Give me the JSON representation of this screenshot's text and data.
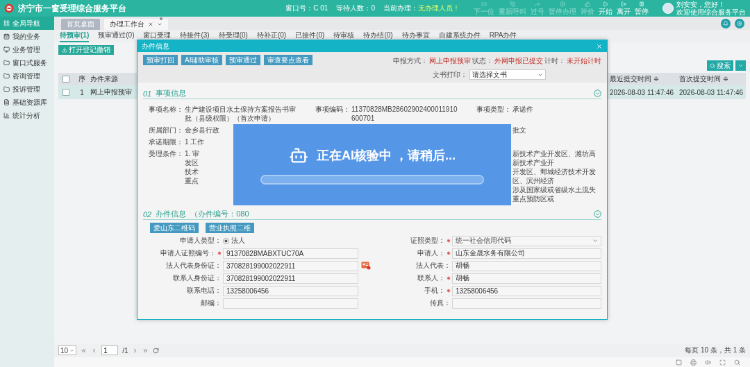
{
  "header": {
    "title": "济宁市一窗受理综合服务平台",
    "window_no": "窗口号：C 01",
    "waiting": "等待人数：0",
    "current_label": "当前办理：",
    "current_value": "无办理人员！",
    "tools": [
      {
        "label": "下一位",
        "disabled": true
      },
      {
        "label": "重新呼叫",
        "disabled": true
      },
      {
        "label": "过号",
        "disabled": true
      },
      {
        "label": "暂停办理",
        "disabled": true
      },
      {
        "label": "评价",
        "disabled": true
      },
      {
        "label": "开始",
        "disabled": false
      },
      {
        "label": "离开",
        "disabled": false
      },
      {
        "label": "暂停",
        "disabled": false
      }
    ],
    "user": {
      "greeting": "刘安安，您好！",
      "org": "欢迎使用综合服务平台"
    }
  },
  "sidebar": [
    {
      "label": "全局导航",
      "selected": true
    },
    {
      "label": "我的业务",
      "selected": false
    },
    {
      "label": "业务管理",
      "selected": false
    },
    {
      "label": "窗口式服务",
      "selected": false
    },
    {
      "label": "咨询管理",
      "selected": false
    },
    {
      "label": "投诉管理",
      "selected": false
    },
    {
      "label": "基础资源库",
      "selected": false
    },
    {
      "label": "统计分析",
      "selected": false
    }
  ],
  "tabs": [
    {
      "label": "首页桌面",
      "selected": false
    },
    {
      "label": "办理工作台",
      "selected": true
    }
  ],
  "subtabs": [
    {
      "label": "待预审(1)",
      "selected": true
    },
    {
      "label": "预审通过(0)",
      "selected": false
    },
    {
      "label": "窗口受理",
      "selected": false
    },
    {
      "label": "待接件(3)",
      "selected": false
    },
    {
      "label": "待受理(0)",
      "selected": false
    },
    {
      "label": "待补正(0)",
      "selected": false
    },
    {
      "label": "已接件(0)",
      "selected": false
    },
    {
      "label": "待审核",
      "selected": false
    },
    {
      "label": "待办结(0)",
      "selected": false
    },
    {
      "label": "待办事宜",
      "selected": false
    },
    {
      "label": "自建系统办件",
      "selected": false
    },
    {
      "label": "RPA办件",
      "selected": false
    }
  ],
  "toolbar": {
    "button": "打开登记撤销",
    "search": "搜索"
  },
  "table": {
    "header_checked": false,
    "columns": [
      "序",
      "办件来源",
      "最近提交时间 ≑",
      "首次提交时间 ≑"
    ],
    "rows": [
      {
        "selected": true,
        "checked": false,
        "cells": [
          "1",
          "网上申报预审",
          "2026-08-03 11:47:46",
          "2026-08-03 11:47:46"
        ]
      }
    ]
  },
  "modal": {
    "title": "办件信息",
    "buttons": [
      "预审打回",
      "AI辅助审核",
      "预审通过",
      "审查要点查看"
    ],
    "status": [
      {
        "label": "申报方式：",
        "value": "网上申报预审"
      },
      {
        "label": "状态：",
        "value": "外网申报已提交"
      },
      {
        "label": "计时：",
        "value": "未开始计时"
      }
    ],
    "print": {
      "label": "文书打印：",
      "value": "请选择文书"
    },
    "section1": {
      "number": "01",
      "title": "事项信息",
      "rows": [
        [
          {
            "label": "事项名称：",
            "lines": [
              "生产建设项目水土保持方案报告书审",
              "批（县级权限）（首次申请）"
            ]
          },
          {
            "label": "事项编码：",
            "lines": [
              "11370828MB28602902400011910",
              "600701"
            ]
          },
          {
            "label": "事项类型：",
            "lines": [
              "承诺件"
            ]
          }
        ],
        [
          {
            "label": "所属部门：",
            "lines": [
              "金乡县行政"
            ]
          },
          null,
          {
            "lines": [
              "批文"
            ]
          }
        ],
        [
          {
            "label": "承诺期限：",
            "lines": [
              "1 工作"
            ]
          },
          null,
          null
        ],
        [
          {
            "label": "受理条件：",
            "lines": [
              "1. 审",
              "发区",
              "技术",
              "重点"
            ]
          },
          null,
          {
            "lines": [
              "新技术产业开发区、潍坊高新技术产业开",
              "开发区、鄄城经济技术开发区、滨州经济",
              "涉及国家级或省级水土流失重点预防区或"
            ]
          }
        ]
      ]
    },
    "section2": {
      "number": "02",
      "title": "办件信息",
      "code": "（办件编号：080",
      "buttons": [
        "爱山东二维码",
        "营业执照二维"
      ],
      "rows": [
        {
          "left": {
            "label": "申请人类型：",
            "kind": "radio",
            "value": "法人",
            "required": false
          },
          "right": {
            "label": "证照类型：",
            "kind": "select",
            "value": "统一社会信用代码",
            "required": true
          }
        },
        {
          "left": {
            "label": "申请人证照编号：",
            "kind": "input",
            "value": "91370828MABXTUC70A",
            "required": true
          },
          "right": {
            "label": "申请人：",
            "kind": "input",
            "value": "山东金晟水务有限公司",
            "required": true
          }
        },
        {
          "left": {
            "label": "法人代表身份证：",
            "kind": "idcard",
            "value": "370828199002022911",
            "required": false
          },
          "right": {
            "label": "法人代表：",
            "kind": "input",
            "value": "胡畅",
            "required": false
          }
        },
        {
          "left": {
            "label": "联系人身份证：",
            "kind": "input",
            "value": "370828199002022911",
            "required": false
          },
          "right": {
            "label": "联系人：",
            "kind": "input",
            "value": "胡畅",
            "required": true
          }
        },
        {
          "left": {
            "label": "联系电话：",
            "kind": "input",
            "value": "13258006456",
            "required": false
          },
          "right": {
            "label": "手机：",
            "kind": "input",
            "value": "13258006456",
            "required": true
          }
        },
        {
          "left": {
            "label": "邮编：",
            "kind": "input",
            "required": false
          },
          "right": {
            "label": "传真：",
            "kind": "input",
            "required": false
          }
        }
      ]
    },
    "overlay": {
      "message": "正在AI核验中 ，请稍后...",
      "level": 1
    }
  },
  "pager": {
    "page_size": "10",
    "page": "1",
    "total_pages": "/1",
    "summary": "每页 10 条，共 1 条"
  }
}
